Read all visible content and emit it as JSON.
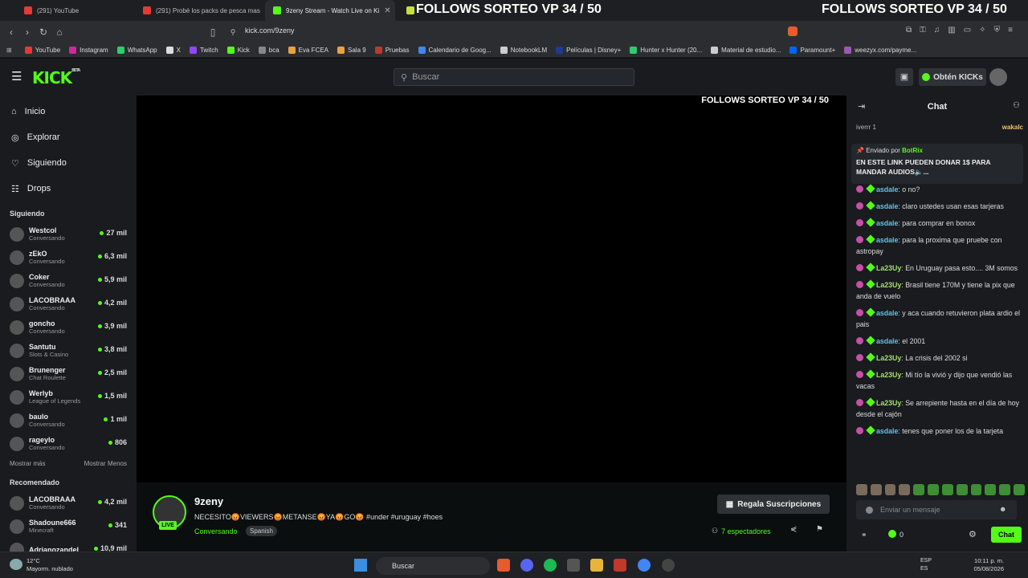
{
  "tabs": [
    {
      "label": "(291) YouTube",
      "color": "#e53935"
    },
    {
      "label": "(291) Probé los packs de pesca mas",
      "color": "#e53935"
    },
    {
      "label": "9zeny Stream - Watch Live on Ki",
      "color": "#53fc18"
    },
    {
      "label": "FOLLOWS SORTEO VP 34 / 50",
      "color": "#53fc18"
    }
  ],
  "overlay_title": "FOLLOWS SORTEO VP 34 / 50",
  "overlay_title_right": "FOLLOWS SORTEO VP 34 / 50",
  "url": "kick.com/9zeny",
  "bookmarks": [
    {
      "label": "YouTube",
      "color": "#e53935"
    },
    {
      "label": "Instagram",
      "color": "#d6249f"
    },
    {
      "label": "WhatsApp",
      "color": "#25d366"
    },
    {
      "label": "X",
      "color": "#dddddd"
    },
    {
      "label": "Twitch",
      "color": "#9146ff"
    },
    {
      "label": "Kick",
      "color": "#53fc18"
    },
    {
      "label": "bca",
      "color": "#888888"
    },
    {
      "label": "Eva FCEA",
      "color": "#e8a33d"
    },
    {
      "label": "Sala 9",
      "color": "#e8a33d"
    },
    {
      "label": "Pruebas",
      "color": "#c0392b"
    },
    {
      "label": "Calendario de Goog...",
      "color": "#4285f4"
    },
    {
      "label": "NotebookLM",
      "color": "#cccccc"
    },
    {
      "label": "Películas | Disney+",
      "color": "#1f3a93"
    },
    {
      "label": "Hunter x Hunter (20...",
      "color": "#2ecc71"
    },
    {
      "label": "Material de estudio...",
      "color": "#cccccc"
    },
    {
      "label": "Paramount+",
      "color": "#0064ff"
    },
    {
      "label": "weezyx.com/payme...",
      "color": "#9b59b6"
    }
  ],
  "header": {
    "logo": "KICK",
    "logo_sup": "BETA",
    "search_placeholder": "Buscar",
    "get_kicks": "Obtén KICKs"
  },
  "nav": [
    "Inicio",
    "Explorar",
    "Siguiendo",
    "Drops"
  ],
  "following_title": "Siguiendo",
  "following": [
    {
      "name": "Westcol",
      "cat": "Conversando",
      "viewers": "27 mil"
    },
    {
      "name": "zEkO",
      "cat": "Conversando",
      "viewers": "6,3 mil"
    },
    {
      "name": "Coker",
      "cat": "Conversando",
      "viewers": "5,9 mil"
    },
    {
      "name": "LACOBRAAA",
      "cat": "Conversando",
      "viewers": "4,2 mil"
    },
    {
      "name": "goncho",
      "cat": "Conversando",
      "viewers": "3,9 mil"
    },
    {
      "name": "Santutu",
      "cat": "Slots & Casino",
      "viewers": "3,8 mil"
    },
    {
      "name": "Brunenger",
      "cat": "Chat Roulette",
      "viewers": "2,5 mil"
    },
    {
      "name": "Werlyb",
      "cat": "League of Legends",
      "viewers": "1,5 mil"
    },
    {
      "name": "baulo",
      "cat": "Conversando",
      "viewers": "1 mil"
    },
    {
      "name": "rageylo",
      "cat": "Conversando",
      "viewers": "806"
    }
  ],
  "show_more": "Mostrar más",
  "show_less": "Mostrar Menos",
  "recommended_title": "Recomendado",
  "recommended": [
    {
      "name": "LACOBRAAA",
      "cat": "Conversando",
      "viewers": "4,2 mil"
    },
    {
      "name": "Shadoune666",
      "cat": "Minecraft",
      "viewers": "341"
    },
    {
      "name": "Adrianozandel",
      "cat": "",
      "viewers": "10,9 mil"
    }
  ],
  "player_overlay": "FOLLOWS SORTEO VP 34 / 50",
  "stream": {
    "name": "9zeny",
    "live": "LIVE",
    "title": "NECESITO😡VIEWERS😡METANSE😡YA😡GO😡 #under #uruguay #hoes",
    "category": "Conversando",
    "language": "Spanish",
    "subs_button": "Regala Suscripciones",
    "viewers": "7 espectadores"
  },
  "chat": {
    "title": "Chat",
    "top_left": "iverrr 1",
    "top_right": "wakalc",
    "pinned_by_prefix": "Enviado por",
    "pinned_by": "BotRix",
    "pinned_msg": "EN ESTE LINK PUEDEN DONAR 1$ PARA MANDAR AUDIOS🔈...",
    "messages": [
      {
        "user": "asdale",
        "text": "o no?",
        "c": "u1"
      },
      {
        "user": "asdale",
        "text": "claro ustedes usan esas tarjeras",
        "c": "u1"
      },
      {
        "user": "asdale",
        "text": "para comprar en bonox",
        "c": "u1"
      },
      {
        "user": "asdale",
        "text": "para la proxima que pruebe con astropay",
        "c": "u1"
      },
      {
        "user": "La23Uy",
        "text": "En Uruguay pasa esto.... 3M somos",
        "c": "u2"
      },
      {
        "user": "La23Uy",
        "text": "Brasil tiene 170M y tiene la pix que anda de vuelo",
        "c": "u2"
      },
      {
        "user": "asdale",
        "text": "y aca cuando retuvieron plata ardio el pais",
        "c": "u1"
      },
      {
        "user": "asdale",
        "text": "el 2001",
        "c": "u1"
      },
      {
        "user": "La23Uy",
        "text": "La crisis del 2002 si",
        "c": "u2"
      },
      {
        "user": "La23Uy",
        "text": "Mi tío la vivió y dijo que vendió las vacas",
        "c": "u2"
      },
      {
        "user": "La23Uy",
        "text": "Se arrepiente hasta en el día de hoy desde el cajón",
        "c": "u2"
      },
      {
        "user": "asdale",
        "text": "tenes que poner los de la tarjeta",
        "c": "u1"
      }
    ],
    "input_placeholder": "Enviar un mensaje",
    "kicks": "0",
    "send": "Chat"
  },
  "taskbar": {
    "temp": "12°C",
    "weather": "Mayorm. nublado",
    "search": "Buscar",
    "lang1": "ESP",
    "lang2": "ES",
    "time": "10:11 p. m.",
    "date": "05/08/2026"
  }
}
